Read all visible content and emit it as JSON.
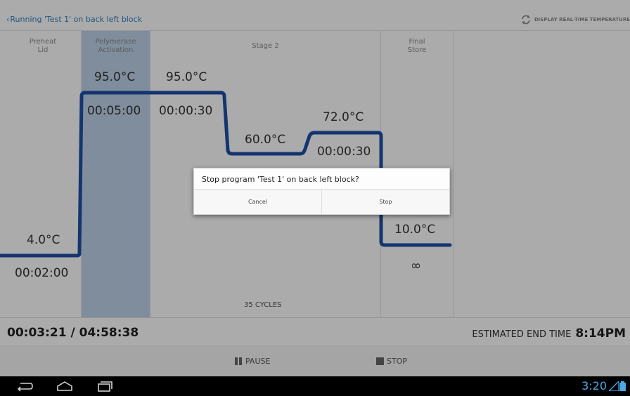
{
  "header": {
    "back_label": "Running 'Test 1' on back left block",
    "realtime_label": "DISPLAY REAL-TIME TEMPERATURE"
  },
  "steps": {
    "preheat": {
      "label_line1": "Preheat",
      "label_line2": "Lid",
      "temp": "4.0°C",
      "time": "00:02:00"
    },
    "activation": {
      "label_line1": "Polymerase",
      "label_line2": "Activation",
      "temp": "95.0°C",
      "time": "00:05:00",
      "active": true
    },
    "stage2": {
      "label": "Stage 2",
      "cycles": "35 CYCLES",
      "denature": {
        "temp": "95.0°C",
        "time": "00:00:30"
      },
      "anneal": {
        "temp": "60.0°C"
      },
      "extend": {
        "temp": "72.0°C",
        "time": "00:00:30"
      }
    },
    "final_store": {
      "label_line1": "Final",
      "label_line2": "Store",
      "temp": "10.0°C",
      "time": "∞"
    }
  },
  "status": {
    "elapsed": "00:03:21 / 04:58:38",
    "eta_label": "ESTIMATED END TIME",
    "eta_value": "8:14PM"
  },
  "controls": {
    "pause_label": "PAUSE",
    "stop_label": "STOP"
  },
  "dialog": {
    "message": "Stop program 'Test 1' on back left block?",
    "cancel_label": "Cancel",
    "stop_label": "Stop"
  },
  "system": {
    "clock": "3:20"
  },
  "colors": {
    "profile_line": "#1f4fa6",
    "active_step_bg": "#bed3ea",
    "link": "#2f7fc1",
    "clock": "#48a9e6"
  }
}
